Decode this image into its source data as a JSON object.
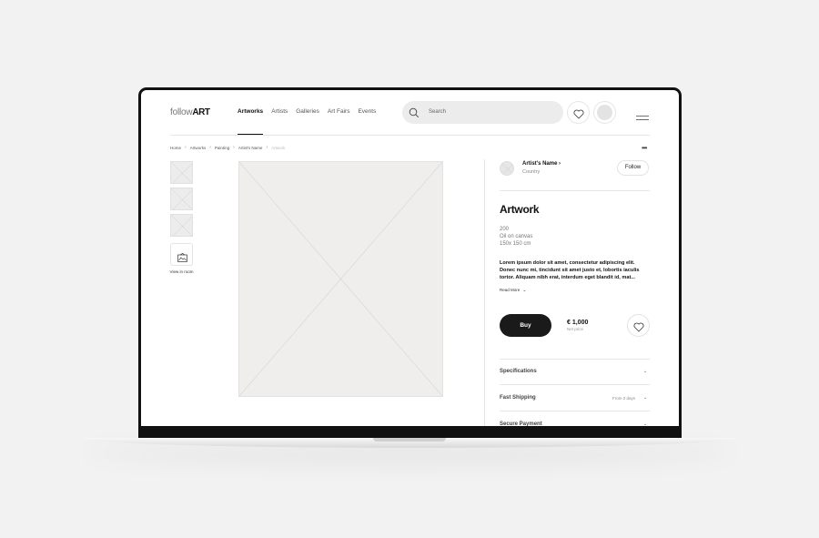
{
  "brand": {
    "logo_light": "follow",
    "logo_bold": "ART"
  },
  "nav": {
    "items": [
      {
        "label": "Artworks",
        "active": true
      },
      {
        "label": "Artists",
        "active": false
      },
      {
        "label": "Galleries",
        "active": false
      },
      {
        "label": "Art Fairs",
        "active": false
      },
      {
        "label": "Events",
        "active": false
      }
    ]
  },
  "search": {
    "placeholder": "Search"
  },
  "icons": {
    "search": "search-icon",
    "wishlist": "heart-icon",
    "account": "avatar",
    "menu": "hamburger-icon",
    "view_in_room": "room-icon",
    "more": "more-dots-icon"
  },
  "breadcrumb": [
    "Home",
    "Artworks",
    "Painting",
    "Artist's Name",
    "Artwork"
  ],
  "gallery": {
    "thumbnail_count": 3,
    "view_in_room_label": "View in room"
  },
  "artist": {
    "name": "Artist's Name",
    "country": "Country",
    "follow_label": "Follow"
  },
  "artwork": {
    "title": "Artwork",
    "year": "200",
    "medium": "Oil on canvas",
    "size": "150x 150 cm",
    "description": "Lorem ipsum dolor sit amet, consectetur adipiscing elit. Donec nunc mi, tincidunt sit amet justo et, lobortis iaculis tortor. Aliquam nibh erat, interdum eget blandit id, mat...",
    "read_more_label": "Read More"
  },
  "purchase": {
    "buy_label": "Buy",
    "price": "€ 1,000",
    "price_note": "Net price"
  },
  "accordion": [
    {
      "label": "Specifications",
      "extra": ""
    },
    {
      "label": "Fast Shipping",
      "extra": "From 2 days"
    },
    {
      "label": "Secure Payment",
      "extra": ""
    }
  ],
  "colors": {
    "accent": "#111111",
    "background": "#f2f2f2",
    "placeholder": "#efeeec"
  }
}
